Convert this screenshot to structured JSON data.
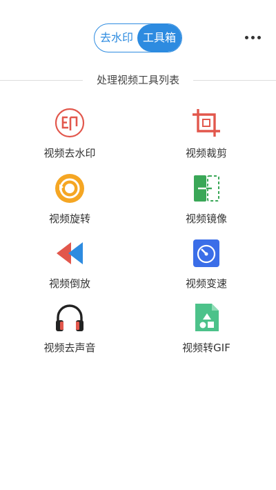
{
  "header": {
    "tab_watermark": "去水印",
    "tab_toolbox": "工具箱",
    "more_icon": "more-dots-icon"
  },
  "section": {
    "title": "处理视频工具列表"
  },
  "tools": [
    {
      "label": "视频去水印",
      "icon": "stamp-icon",
      "color": "#e2574c"
    },
    {
      "label": "视频裁剪",
      "icon": "crop-icon",
      "color": "#e2574c"
    },
    {
      "label": "视频旋转",
      "icon": "rotate-icon",
      "color": "#f5a623"
    },
    {
      "label": "视频镜像",
      "icon": "mirror-icon",
      "color": "#3aa757"
    },
    {
      "label": "视频倒放",
      "icon": "rewind-icon",
      "color": "#e2574c"
    },
    {
      "label": "视频变速",
      "icon": "speedometer-icon",
      "color": "#3b6ee8"
    },
    {
      "label": "视频去声音",
      "icon": "headphones-icon",
      "color": "#e2574c"
    },
    {
      "label": "视频转GIF",
      "icon": "gif-file-icon",
      "color": "#4cc28a"
    }
  ],
  "colors": {
    "accent": "#2d8be0"
  }
}
